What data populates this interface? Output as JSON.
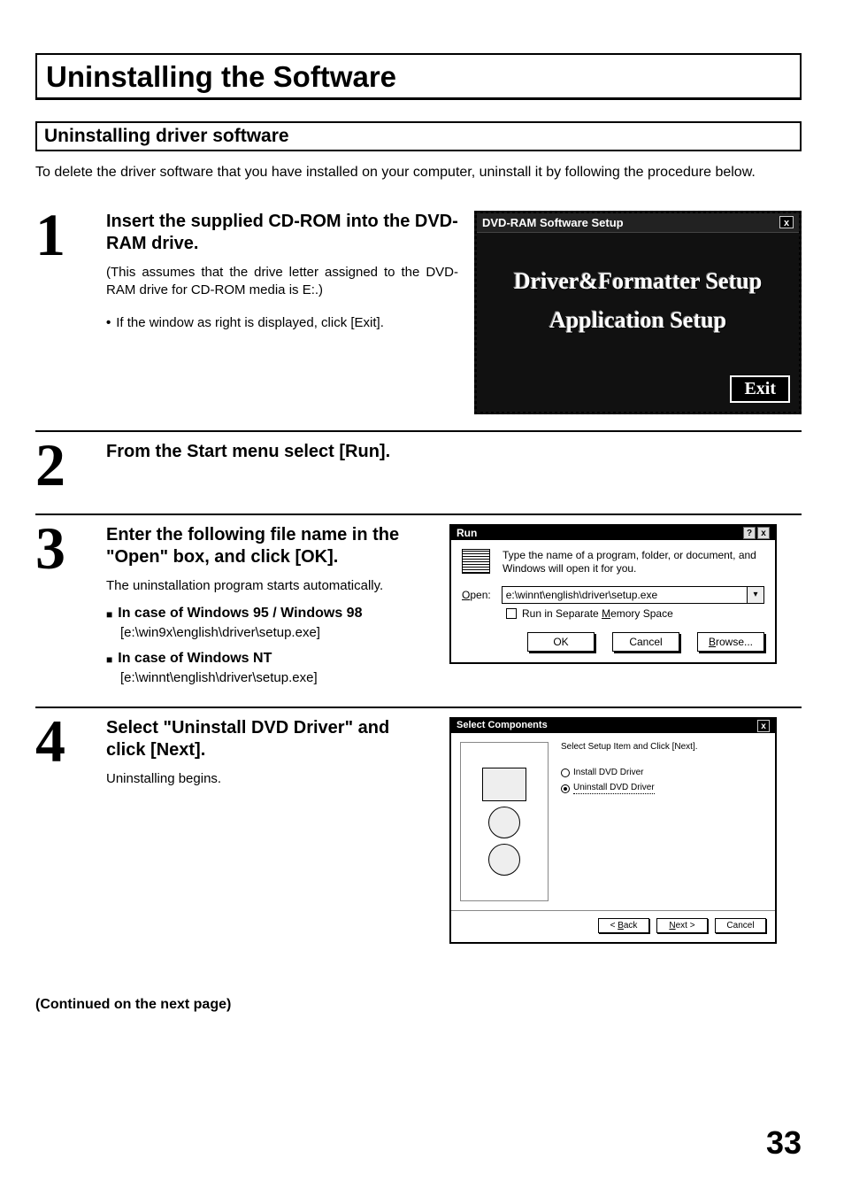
{
  "title": "Uninstalling the Software",
  "subtitle": "Uninstalling driver software",
  "intro": "To delete the driver software that you have installed on your computer, uninstall it by following the procedure below.",
  "steps": {
    "s1": {
      "num": "1",
      "head": "Insert the supplied CD-ROM into the DVD-RAM drive.",
      "note": "(This assumes that the drive letter assigned to the DVD-RAM drive for CD-ROM media is E:.)",
      "bullet": "If the window as right is displayed, click [Exit]."
    },
    "s2": {
      "num": "2",
      "head": "From the Start menu select [Run]."
    },
    "s3": {
      "num": "3",
      "head": "Enter the following file name in the \"Open\" box, and click [OK].",
      "after": "The uninstallation program starts automatically.",
      "case1_title": "In case of Windows 95 / Windows 98",
      "case1_path": "[e:\\win9x\\english\\driver\\setup.exe]",
      "case2_title": "In case of Windows NT",
      "case2_path": "[e:\\winnt\\english\\driver\\setup.exe]"
    },
    "s4": {
      "num": "4",
      "head": "Select \"Uninstall DVD Driver\" and click [Next].",
      "after": "Uninstalling begins."
    }
  },
  "fig_dvdram": {
    "title": "DVD-RAM Software Setup",
    "btn1": "Driver&Formatter Setup",
    "btn2": "Application Setup",
    "exit": "Exit",
    "close": "x"
  },
  "fig_run": {
    "title": "Run",
    "help": "?",
    "close": "x",
    "desc": "Type the name of a program, folder, or document, and Windows will open it for you.",
    "open_label": "Open:",
    "open_value": "e:\\winnt\\english\\driver\\setup.exe",
    "memspace": "Run in Separate Memory Space",
    "ok": "OK",
    "cancel": "Cancel",
    "browse": "Browse..."
  },
  "fig_sel": {
    "title": "Select Components",
    "close": "x",
    "instr": "Select Setup Item and Click [Next].",
    "opt1": "Install DVD Driver",
    "opt2": "Uninstall DVD Driver",
    "back": "< Back",
    "next": "Next >",
    "cancel": "Cancel"
  },
  "continued": "(Continued on the next page)",
  "page_number": "33"
}
